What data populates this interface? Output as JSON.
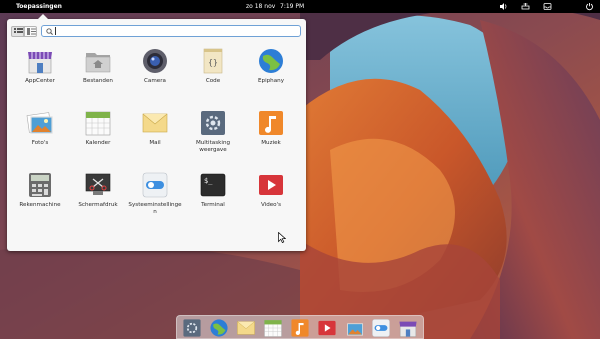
{
  "panel": {
    "applications_label": "Toepassingen",
    "date": "zo 18 nov",
    "time": "7:19 PM",
    "indicators": [
      "volume-icon",
      "network-icon",
      "notifications-icon",
      "power-icon"
    ]
  },
  "launcher": {
    "search": {
      "value": "",
      "placeholder": ""
    },
    "apps": [
      {
        "label": "AppCenter",
        "icon": "appcenter-icon"
      },
      {
        "label": "Bestanden",
        "icon": "folder-icon"
      },
      {
        "label": "Camera",
        "icon": "camera-icon"
      },
      {
        "label": "Code",
        "icon": "code-icon"
      },
      {
        "label": "Epiphany",
        "icon": "epiphany-icon"
      },
      {
        "label": "Foto's",
        "icon": "photos-icon"
      },
      {
        "label": "Kalender",
        "icon": "calendar-icon"
      },
      {
        "label": "Mail",
        "icon": "mail-icon"
      },
      {
        "label": "Multitasking\nweergave",
        "icon": "multitasking-icon"
      },
      {
        "label": "Muziek",
        "icon": "music-icon"
      },
      {
        "label": "Rekenmachine",
        "icon": "calculator-icon"
      },
      {
        "label": "Schermafdruk",
        "icon": "screenshot-icon"
      },
      {
        "label": "Systeeminstellinge\nn",
        "icon": "settings-icon"
      },
      {
        "label": "Terminal",
        "icon": "terminal-icon"
      },
      {
        "label": "Video's",
        "icon": "videos-icon"
      }
    ]
  },
  "dock": {
    "items": [
      "multitasking-icon",
      "epiphany-icon",
      "mail-icon",
      "calendar-icon",
      "music-icon",
      "videos-icon",
      "photos-icon",
      "settings-icon",
      "appcenter-icon"
    ]
  },
  "colors": {
    "panel_bg": "#000000",
    "launcher_bg": "#f7f7f7",
    "search_focus": "#6fa1d6"
  }
}
